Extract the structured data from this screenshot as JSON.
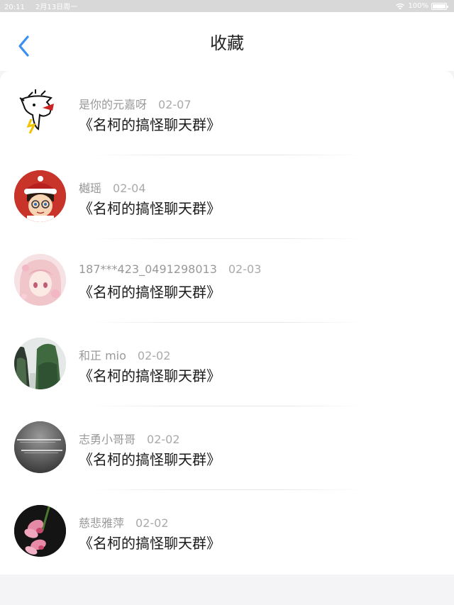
{
  "status_bar": {
    "time": "20:11",
    "date": "2月13日周一",
    "battery": "100%",
    "wifi_icon": "wifi-icon",
    "battery_level": 1.0
  },
  "header": {
    "title": "收藏",
    "back_icon": "chevron-left-icon",
    "accent_color": "#3b8ff0"
  },
  "favorites": [
    {
      "user": "是你的元嘉呀",
      "date": "02-07",
      "title": "《名柯的搞怪聊天群》",
      "avatar": "cartoon-sketch-avatar"
    },
    {
      "user": "樾瑶",
      "date": "02-04",
      "title": "《名柯的搞怪聊天群》",
      "avatar": "conan-avatar"
    },
    {
      "user": "187***423_0491298013",
      "date": "02-03",
      "title": "《名柯的搞怪聊天群》",
      "avatar": "pink-anime-girl-avatar"
    },
    {
      "user": "和正 mio",
      "date": "02-02",
      "title": "《名柯的搞怪聊天群》",
      "avatar": "mountain-landscape-avatar"
    },
    {
      "user": "志勇小哥哥",
      "date": "02-02",
      "title": "《名柯的搞怪聊天群》",
      "avatar": "grayscale-text-avatar"
    },
    {
      "user": "慈悲雅萍",
      "date": "02-02",
      "title": "《名柯的搞怪聊天群》",
      "avatar": "pink-flower-avatar"
    }
  ]
}
